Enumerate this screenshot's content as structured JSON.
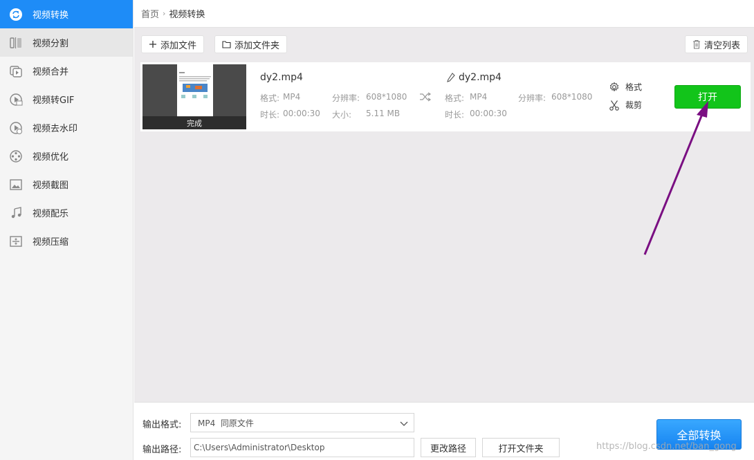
{
  "sidebar": {
    "items": [
      {
        "label": "视频转换",
        "icon": "convert-icon"
      },
      {
        "label": "视频分割",
        "icon": "split-icon"
      },
      {
        "label": "视频合并",
        "icon": "merge-icon"
      },
      {
        "label": "视频转GIF",
        "icon": "gif-icon"
      },
      {
        "label": "视频去水印",
        "icon": "remove-watermark-icon"
      },
      {
        "label": "视频优化",
        "icon": "optimize-icon"
      },
      {
        "label": "视频截图",
        "icon": "screenshot-icon"
      },
      {
        "label": "视频配乐",
        "icon": "music-icon"
      },
      {
        "label": "视频压缩",
        "icon": "compress-icon"
      }
    ]
  },
  "breadcrumb": {
    "home": "首页",
    "current": "视频转换"
  },
  "toolbar": {
    "add_file": "添加文件",
    "add_folder": "添加文件夹",
    "clear_list": "清空列表"
  },
  "file": {
    "status": "完成",
    "source": {
      "name": "dy2.mp4",
      "format_label": "格式:",
      "format": "MP4",
      "resolution_label": "分辨率:",
      "resolution": "608*1080",
      "duration_label": "时长:",
      "duration": "00:00:30",
      "size_label": "大小:",
      "size": "5.11 MB"
    },
    "output": {
      "name": "dy2.mp4",
      "format_label": "格式:",
      "format": "MP4",
      "resolution_label": "分辨率:",
      "resolution": "608*1080",
      "duration_label": "时长:",
      "duration": "00:00:30"
    },
    "actions": {
      "format": "格式",
      "crop": "裁剪",
      "open": "打开"
    }
  },
  "bottom": {
    "format_label": "输出格式:",
    "format_value": "MP4  同原文件",
    "path_label": "输出路径:",
    "path_value": "C:\\Users\\Administrator\\Desktop",
    "change_path": "更改路径",
    "open_folder": "打开文件夹",
    "convert_all": "全部转换"
  },
  "watermark": "https://blog.csdn.net/ban_gong",
  "colors": {
    "accent": "#1e8cf7",
    "open_button": "#12c41a",
    "annotation_arrow": "#7a0f82"
  }
}
